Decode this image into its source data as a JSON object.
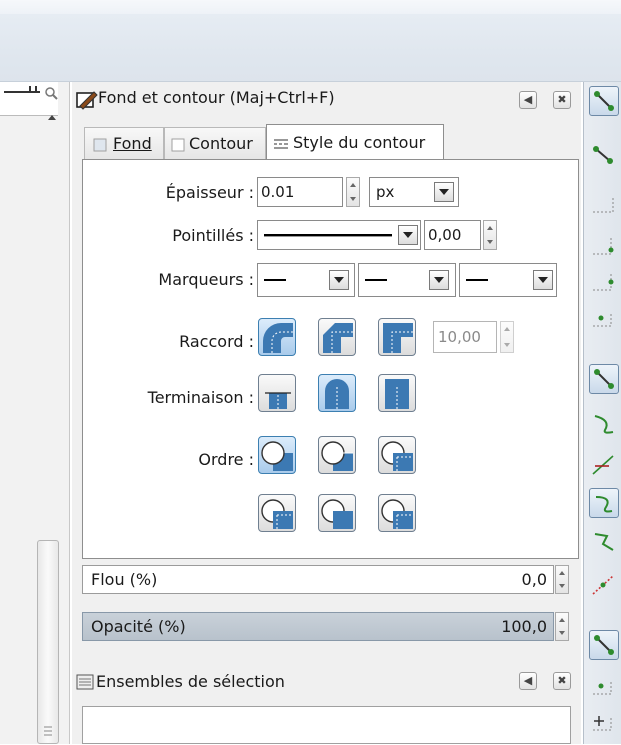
{
  "dialog": {
    "title": "Fond et contour (Maj+Ctrl+F)",
    "tabs": [
      {
        "label": "Fond"
      },
      {
        "label": "Contour"
      },
      {
        "label": "Style du contour",
        "active": true
      }
    ]
  },
  "stroke_style": {
    "width_label": "Épaisseur :",
    "width_value": "0.01",
    "unit": "px",
    "dashes_label": "Pointillés :",
    "dashes_offset": "0,00",
    "markers_label": "Marqueurs :",
    "join_label": "Raccord :",
    "miter_limit": "10,00",
    "cap_label": "Terminaison :",
    "order_label": "Ordre :",
    "selected": {
      "join": "round",
      "cap": "round",
      "order": 0
    }
  },
  "blur": {
    "label": "Flou (%)",
    "value": "0,0"
  },
  "opacity": {
    "label": "Opacité (%)",
    "value": "100,0"
  },
  "selection_sets": {
    "title": "Ensembles de sélection"
  },
  "colors": {
    "accent": "#3c7fb1",
    "icon_blue": "#3c79b3"
  }
}
